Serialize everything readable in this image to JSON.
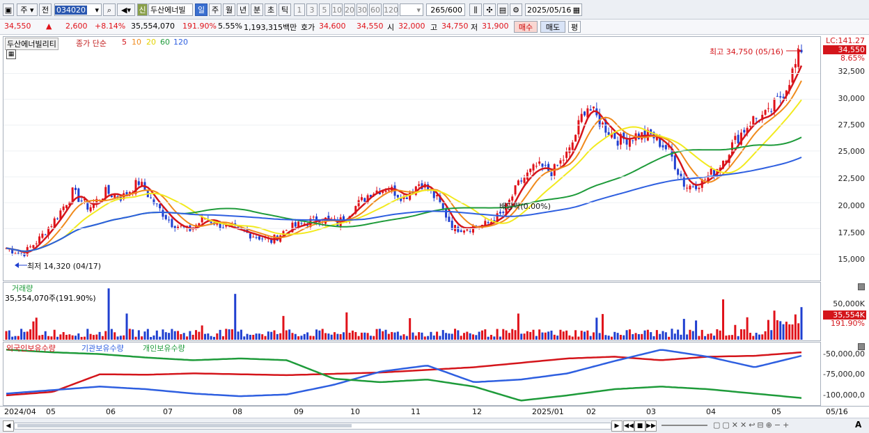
{
  "toolbar": {
    "market_label": "주",
    "period_label": "전",
    "code": "034020",
    "new_badge": "신",
    "stock_name": "두산에너빌",
    "period_tabs": [
      "일",
      "주",
      "월",
      "년",
      "분",
      "초",
      "틱"
    ],
    "interval_buttons": [
      "1",
      "3",
      "5",
      "10",
      "20",
      "30",
      "60",
      "120"
    ],
    "count_display": "265/600",
    "date": "2025/05/16"
  },
  "quote": {
    "price": "34,550",
    "arrow": "▲",
    "change": "2,600",
    "change_pct": "+8.14%",
    "volume": "35,554,070",
    "volume_ratio": "191.90%",
    "turnover": "5.55%",
    "amount": "1,193,315백만",
    "bid_label": "호가",
    "bid1": "34,600",
    "bid2": "34,550",
    "open_label": "시",
    "open": "32,000",
    "high_label": "고",
    "high": "34,750",
    "low_label": "저",
    "low": "31,900",
    "buy_button": "매수",
    "sell_button": "매도",
    "avg_button": "평"
  },
  "price_pane": {
    "name_tag": "두산에너빌리티",
    "legend_prefix": "종가 단순",
    "ma_labels": [
      "5",
      "10",
      "20",
      "60",
      "120"
    ],
    "ma_colors": [
      "#d4151b",
      "#f08a1c",
      "#f2ea1e",
      "#1e9b3a",
      "#2e5fe0"
    ],
    "lc_label": "LC:141.27",
    "current_price_tag": "34,550",
    "current_pct_tag": "8.65%",
    "high_marker": "최고 34,750 (05/16)",
    "low_marker": "최저 14,320 (04/17)",
    "dividend_marker": "배당락(0.00%)",
    "y_ticks": [
      "32,500",
      "30,000",
      "27,500",
      "25,000",
      "22,500",
      "20,000",
      "17,500",
      "15,000"
    ]
  },
  "volume_pane": {
    "title": "거래량",
    "value_label": "35,554,070주(191.90%)",
    "y_tick": "50,000K",
    "current_tag": "35,554K",
    "current_pct": "191.90%"
  },
  "holdings_pane": {
    "legends": [
      "외국인보유수량",
      "기관보유수량",
      "개인보유수량"
    ],
    "colors": [
      "#d4151b",
      "#2e5fe0",
      "#1e9b3a"
    ],
    "y_ticks": [
      "-50,000,00",
      "-75,000,00",
      "-100,000,0"
    ]
  },
  "x_axis_labels": [
    "2024/04",
    "05",
    "06",
    "07",
    "08",
    "09",
    "10",
    "11",
    "12",
    "2025/01",
    "02",
    "03",
    "04",
    "05",
    "05/16"
  ],
  "chart_data": [
    {
      "type": "candlestick",
      "title": "두산에너빌리티",
      "x": [
        "2024/04",
        "05",
        "06",
        "07",
        "08",
        "09",
        "10",
        "11",
        "12",
        "2025/01",
        "02",
        "03",
        "04",
        "05",
        "05/16"
      ],
      "series": [
        {
          "name": "종가",
          "values": [
            15600,
            15000,
            16500,
            18500,
            21000,
            19500,
            21000,
            20500,
            22000,
            19800,
            18000,
            17300,
            18500,
            17800,
            17300,
            16800,
            16300,
            17500,
            18000,
            18500,
            18000,
            19500,
            21000,
            21500,
            20500,
            22000,
            20300,
            17500,
            17600,
            17900,
            19000,
            22000,
            23500,
            23000,
            25000,
            29500,
            27500,
            26000,
            26500,
            26500,
            25000,
            21500,
            22000,
            23500,
            26000,
            28000,
            28500,
            31000,
            34550
          ]
        }
      ],
      "moving_averages": [
        "5",
        "10",
        "20",
        "60",
        "120"
      ],
      "high": {
        "label": "최고",
        "value": 34750,
        "date": "05/16"
      },
      "low": {
        "label": "최저",
        "value": 14320,
        "date": "04/17"
      },
      "ylim": [
        13000,
        35500
      ]
    },
    {
      "type": "bar",
      "title": "거래량",
      "last_value": 35554070,
      "ylim": [
        0,
        60000000
      ]
    },
    {
      "type": "line",
      "series": [
        {
          "name": "외국인보유수량",
          "values": [
            -102000000,
            -98000000,
            -78000000,
            -78500000,
            -77000000,
            -78000000,
            -79000000,
            -77500000,
            -76000000,
            -73000000,
            -70000000,
            -65000000,
            -60000000,
            -58000000,
            -62000000,
            -58000000,
            -57000000,
            -53000000
          ]
        },
        {
          "name": "기관보유수량",
          "values": [
            -100000000,
            -96000000,
            -92000000,
            -95000000,
            -100000000,
            -103000000,
            -101000000,
            -90000000,
            -75000000,
            -68000000,
            -87000000,
            -84000000,
            -77000000,
            -63000000,
            -50000000,
            -58000000,
            -70000000,
            -57000000
          ]
        },
        {
          "name": "개인보유수량",
          "values": [
            -50000000,
            -53000000,
            -55000000,
            -59000000,
            -62000000,
            -60000000,
            -62000000,
            -83000000,
            -87000000,
            -84000000,
            -92000000,
            -108000000,
            -102000000,
            -95000000,
            -92000000,
            -95000000,
            -100000000,
            -105000000
          ]
        }
      ],
      "ylim": [
        -110000000,
        -45000000
      ]
    }
  ]
}
